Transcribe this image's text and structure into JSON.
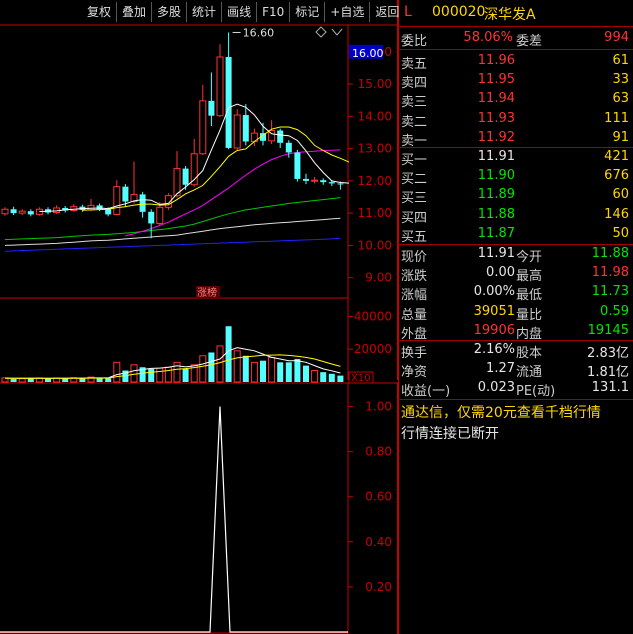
{
  "toolbar": {
    "buttons": [
      "复权",
      "叠加",
      "多股",
      "统计",
      "画线",
      "F10",
      "标记",
      "+自选",
      "返回"
    ]
  },
  "stock": {
    "market_flag": "L",
    "code": "000020",
    "name": "深华发A"
  },
  "orderbook": {
    "ratio_label": "委比",
    "ratio_value": "58.06%",
    "diff_label": "委差",
    "diff_value": "994",
    "sells": [
      {
        "label": "卖五",
        "price": "11.96",
        "volume": "61"
      },
      {
        "label": "卖四",
        "price": "11.95",
        "volume": "33"
      },
      {
        "label": "卖三",
        "price": "11.94",
        "volume": "63"
      },
      {
        "label": "卖二",
        "price": "11.93",
        "volume": "111"
      },
      {
        "label": "卖一",
        "price": "11.92",
        "volume": "91"
      }
    ],
    "buys": [
      {
        "label": "买一",
        "price": "11.91",
        "volume": "421"
      },
      {
        "label": "买二",
        "price": "11.90",
        "volume": "676"
      },
      {
        "label": "买三",
        "price": "11.89",
        "volume": "60"
      },
      {
        "label": "买四",
        "price": "11.88",
        "volume": "146"
      },
      {
        "label": "买五",
        "price": "11.87",
        "volume": "50"
      }
    ]
  },
  "quote": [
    {
      "l1": "现价",
      "v1": "11.91",
      "l2": "今开",
      "v2": "11.88"
    },
    {
      "l1": "涨跌",
      "v1": "0.00",
      "l2": "最高",
      "v2": "11.98"
    },
    {
      "l1": "涨幅",
      "v1": "0.00%",
      "l2": "最低",
      "v2": "11.73"
    },
    {
      "l1": "总量",
      "v1": "39051",
      "l2": "量比",
      "v2": "0.59"
    },
    {
      "l1": "外盘",
      "v1": "19906",
      "l2": "内盘",
      "v2": "19145"
    }
  ],
  "fundamentals": [
    {
      "l1": "换手",
      "v1": "2.16%",
      "l2": "股本",
      "v2": "2.83亿"
    },
    {
      "l1": "净资",
      "v1": "1.27",
      "l2": "流通",
      "v2": "1.81亿"
    },
    {
      "l1": "收益(一)",
      "v1": "0.023",
      "l2": "PE(动)",
      "v2": "131.1"
    }
  ],
  "notices": [
    "通达信，仅需20元查看千档行情",
    "行情连接已断开"
  ],
  "colors": {
    "up": "#ff3232",
    "down": "#54ffff",
    "ma5": "#ffffff",
    "ma10": "#ffff00",
    "ma20": "#ff00ff",
    "ma30": "#00c800",
    "ma60": "#dcdcdc",
    "ma120": "#2020ff"
  },
  "chart_data": [
    {
      "type": "candlestick",
      "price_ticks": [
        "16.00",
        "15.00",
        "14.00",
        "13.00",
        "12.00",
        "11.00",
        "10.00",
        "9.00"
      ],
      "y_values": [
        16,
        15,
        14,
        13,
        12,
        11,
        10,
        9
      ],
      "ylim": [
        8.4,
        16.8
      ],
      "current_price_label": "16.00",
      "max_annotation": "16.60",
      "event_marker": "涨榜",
      "candles": [
        [
          10.98,
          11.12,
          11.18,
          10.92
        ],
        [
          11.12,
          11.0,
          11.2,
          10.94
        ],
        [
          11.0,
          11.06,
          11.12,
          10.94
        ],
        [
          11.06,
          10.96,
          11.12,
          10.9
        ],
        [
          10.96,
          11.12,
          11.18,
          10.92
        ],
        [
          11.12,
          11.02,
          11.18,
          10.96
        ],
        [
          11.02,
          11.16,
          11.24,
          10.98
        ],
        [
          11.16,
          11.08,
          11.22,
          11.02
        ],
        [
          11.08,
          11.2,
          11.28,
          11.04
        ],
        [
          11.2,
          11.1,
          11.26,
          11.04
        ],
        [
          11.1,
          11.24,
          11.44,
          11.06
        ],
        [
          11.24,
          11.12,
          11.3,
          11.06
        ],
        [
          11.12,
          10.96,
          11.18,
          10.9
        ],
        [
          10.96,
          11.82,
          12.02,
          10.94
        ],
        [
          11.82,
          11.36,
          11.9,
          11.2
        ],
        [
          11.36,
          11.58,
          12.6,
          11.3
        ],
        [
          11.58,
          11.04,
          11.66,
          10.86
        ],
        [
          11.04,
          10.68,
          11.12,
          10.22
        ],
        [
          10.68,
          11.18,
          11.34,
          10.62
        ],
        [
          11.18,
          11.54,
          11.62,
          11.1
        ],
        [
          11.54,
          12.38,
          12.92,
          11.48
        ],
        [
          12.38,
          11.88,
          12.46,
          11.72
        ],
        [
          11.88,
          12.84,
          13.3,
          11.82
        ],
        [
          12.84,
          14.48,
          14.98,
          12.8
        ],
        [
          14.48,
          14.02,
          15.36,
          13.7
        ],
        [
          14.02,
          15.84,
          16.24,
          13.98
        ],
        [
          15.84,
          13.02,
          16.6,
          12.98
        ],
        [
          13.02,
          14.04,
          14.22,
          12.96
        ],
        [
          14.04,
          13.22,
          14.38,
          13.1
        ],
        [
          13.22,
          13.48,
          13.62,
          13.08
        ],
        [
          13.48,
          13.24,
          13.8,
          13.1
        ],
        [
          13.24,
          13.56,
          13.88,
          13.14
        ],
        [
          13.56,
          13.18,
          13.62,
          13.02
        ],
        [
          13.18,
          12.88,
          13.26,
          12.72
        ],
        [
          12.88,
          12.06,
          12.96,
          11.98
        ],
        [
          12.06,
          12.0,
          12.22,
          11.9
        ],
        [
          12.0,
          12.02,
          12.12,
          11.92
        ],
        [
          12.02,
          11.96,
          12.08,
          11.88
        ],
        [
          11.96,
          11.92,
          12.02,
          11.84
        ],
        [
          11.92,
          11.91,
          11.98,
          11.73
        ]
      ],
      "ma_series": {
        "ma5": {
          "start": 4,
          "values": [
            11.05,
            11.06,
            11.07,
            11.1,
            11.12,
            11.14,
            11.15,
            11.16,
            11.14,
            11.22,
            11.29,
            11.38,
            11.42,
            11.4,
            11.27,
            11.3,
            11.6,
            11.81,
            12.04,
            12.32,
            12.96,
            13.57,
            14.27,
            14.38,
            14.28,
            14.04,
            13.69,
            13.46,
            13.42,
            13.4,
            13.25,
            12.93,
            12.56,
            12.26,
            12.0,
            11.95,
            11.93
          ]
        },
        "ma10": {
          "start": 9,
          "values": [
            11.09,
            11.1,
            11.11,
            11.12,
            11.17,
            11.2,
            11.25,
            11.28,
            11.28,
            11.25,
            11.26,
            11.42,
            11.6,
            11.72,
            11.86,
            12.14,
            12.44,
            12.76,
            12.94,
            12.99,
            13.22,
            13.41,
            13.6,
            13.67,
            13.67,
            13.59,
            13.4,
            13.1,
            12.94,
            12.8,
            12.7,
            12.58
          ]
        },
        "ma20": {
          "start": 14,
          "values": [
            10.3,
            10.36,
            10.44,
            10.52,
            10.62,
            10.72,
            10.85,
            10.98,
            11.1,
            11.24,
            11.42,
            11.6,
            11.78,
            11.98,
            12.18,
            12.36,
            12.52,
            12.66,
            12.76,
            12.84,
            12.88,
            12.9,
            12.92,
            12.94,
            12.95,
            12.96
          ]
        },
        "ma30": {
          "start": 0,
          "values": [
            10.18,
            10.19,
            10.2,
            10.21,
            10.22,
            10.23,
            10.24,
            10.26,
            10.28,
            10.3,
            10.32,
            10.33,
            10.34,
            10.36,
            10.38,
            10.4,
            10.43,
            10.46,
            10.49,
            10.52,
            10.56,
            10.6,
            10.66,
            10.74,
            10.82,
            10.9,
            10.98,
            11.04,
            11.1,
            11.14,
            11.18,
            11.22,
            11.26,
            11.3,
            11.33,
            11.36,
            11.39,
            11.42,
            11.45,
            11.48
          ]
        },
        "ma60": {
          "start": 0,
          "values": [
            10.0,
            10.01,
            10.02,
            10.03,
            10.04,
            10.05,
            10.06,
            10.08,
            10.1,
            10.12,
            10.14,
            10.15,
            10.16,
            10.18,
            10.2,
            10.22,
            10.24,
            10.26,
            10.28,
            10.3,
            10.32,
            10.36,
            10.4,
            10.44,
            10.48,
            10.52,
            10.55,
            10.58,
            10.61,
            10.64,
            10.66,
            10.68,
            10.7,
            10.72,
            10.74,
            10.76,
            10.78,
            10.8,
            10.82,
            10.84
          ]
        },
        "ma120": {
          "start": 0,
          "values": [
            9.82,
            9.83,
            9.84,
            9.85,
            9.86,
            9.87,
            9.88,
            9.89,
            9.9,
            9.91,
            9.92,
            9.93,
            9.94,
            9.95,
            9.96,
            9.97,
            9.98,
            9.99,
            10.0,
            10.01,
            10.02,
            10.03,
            10.04,
            10.05,
            10.06,
            10.07,
            10.08,
            10.09,
            10.1,
            10.11,
            10.12,
            10.13,
            10.14,
            10.15,
            10.16,
            10.17,
            10.18,
            10.19,
            10.2,
            10.22
          ]
        }
      }
    },
    {
      "type": "bar",
      "name": "volume",
      "tick_labels": [
        "40000",
        "20000",
        "X10"
      ],
      "ylim": [
        0,
        50000
      ],
      "values": [
        2500,
        1800,
        2000,
        2200,
        2500,
        2000,
        2400,
        2200,
        2600,
        2300,
        3000,
        2600,
        2200,
        12000,
        7000,
        10500,
        9000,
        8000,
        8500,
        9000,
        12000,
        8000,
        10500,
        16000,
        18000,
        22000,
        34000,
        19000,
        16000,
        12000,
        13000,
        15000,
        12000,
        12000,
        14000,
        10000,
        7000,
        6000,
        5000,
        3900
      ],
      "ma_lines": {
        "a": [
          2400,
          2300,
          2300,
          2300,
          2300,
          2200,
          2300,
          2300,
          2400,
          2400,
          2500,
          2500,
          2500,
          4500,
          5500,
          6800,
          7600,
          8300,
          8500,
          9000,
          9900,
          9200,
          9800,
          11000,
          12500,
          14000,
          19000,
          21000,
          20000,
          19000,
          17000,
          15000,
          14000,
          13000,
          13000,
          12000,
          10000,
          8000,
          6800,
          5500
        ],
        "b": [
          2300,
          2300,
          2300,
          2300,
          2300,
          2300,
          2300,
          2300,
          2300,
          2300,
          2400,
          2400,
          2400,
          3300,
          3900,
          4700,
          5300,
          5900,
          6400,
          7000,
          7800,
          8200,
          8800,
          9600,
          10500,
          11800,
          13500,
          14700,
          15400,
          15800,
          16300,
          16400,
          16500,
          16200,
          15700,
          15000,
          14000,
          12500,
          11000,
          9500
        ]
      }
    },
    {
      "type": "line",
      "name": "indicator",
      "ylim": [
        0,
        1.1
      ],
      "y_ticks": [
        "1.00",
        "0.80",
        "0.60",
        "0.40",
        "0.20"
      ],
      "y_values": [
        1.0,
        0.8,
        0.6,
        0.4,
        0.2
      ],
      "peak_index": 25,
      "peak_value": 1.0
    }
  ]
}
